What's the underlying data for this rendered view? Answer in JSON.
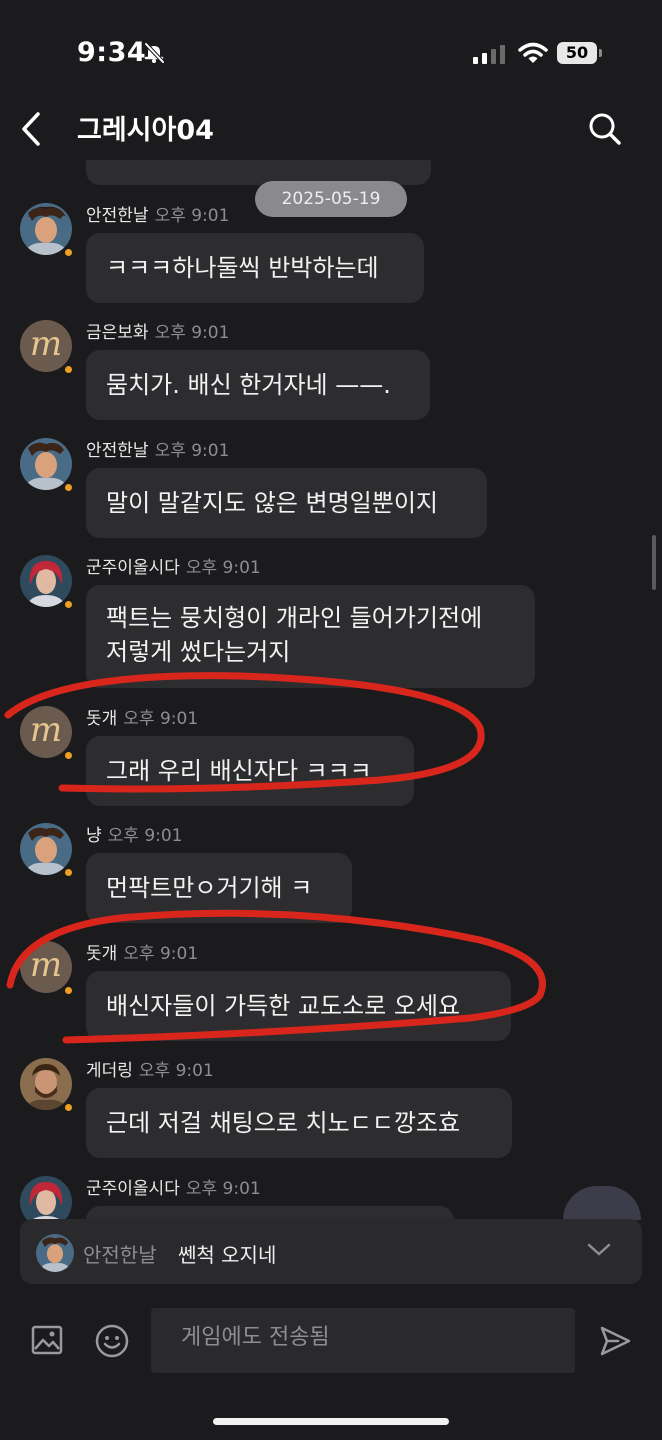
{
  "status_bar": {
    "time": "9:34",
    "battery": "50"
  },
  "header": {
    "title": "그레시아04"
  },
  "date_divider": "2025-05-19",
  "messages": [
    {
      "name": "안전한날",
      "time": "오후 9:01",
      "avatar": "warrior",
      "lines": [
        "ㅋㅋㅋ하나둘씩 반박하는데"
      ]
    },
    {
      "name": "금은보화",
      "time": "오후 9:01",
      "avatar": "m-logo",
      "lines": [
        "뭄치가. 배신 한거자네 ——."
      ]
    },
    {
      "name": "안전한날",
      "time": "오후 9:01",
      "avatar": "warrior",
      "lines": [
        "말이 말같지도 않은 변명일뿐이지"
      ]
    },
    {
      "name": "군주이올시다",
      "time": "오후 9:01",
      "avatar": "redhair",
      "lines": [
        "팩트는 뭉치형이 개라인 들어가기전에",
        " 저렇게 썼다는거지"
      ]
    },
    {
      "name": "돗개",
      "time": "오후 9:01",
      "avatar": "m-logo",
      "lines": [
        "그래 우리 배신자다 ㅋㅋㅋ"
      ]
    },
    {
      "name": "냥",
      "time": "오후 9:01",
      "avatar": "warrior",
      "lines": [
        "먼팍트만ㅇ거기해 ㅋ"
      ]
    },
    {
      "name": "돗개",
      "time": "오후 9:01",
      "avatar": "m-logo",
      "lines": [
        "배신자들이 가득한 교도소로 오세요"
      ]
    },
    {
      "name": "게더링",
      "time": "오후 9:01",
      "avatar": "bearded",
      "lines": [
        "근데 저걸 채팅으로 치노ㄷㄷ깡조효"
      ]
    },
    {
      "name": "군주이올시다",
      "time": "오후 9:01",
      "avatar": "redhair",
      "lines": []
    }
  ],
  "reply_preview": {
    "name": "안전한날",
    "text": "쎈척 오지네"
  },
  "input": {
    "placeholder": "게임에도 전송됨"
  },
  "colors": {
    "background": "#1b1b1d",
    "bubble": "#2d2d30",
    "annotation": "#d9261c",
    "presence": "#f0a020"
  }
}
